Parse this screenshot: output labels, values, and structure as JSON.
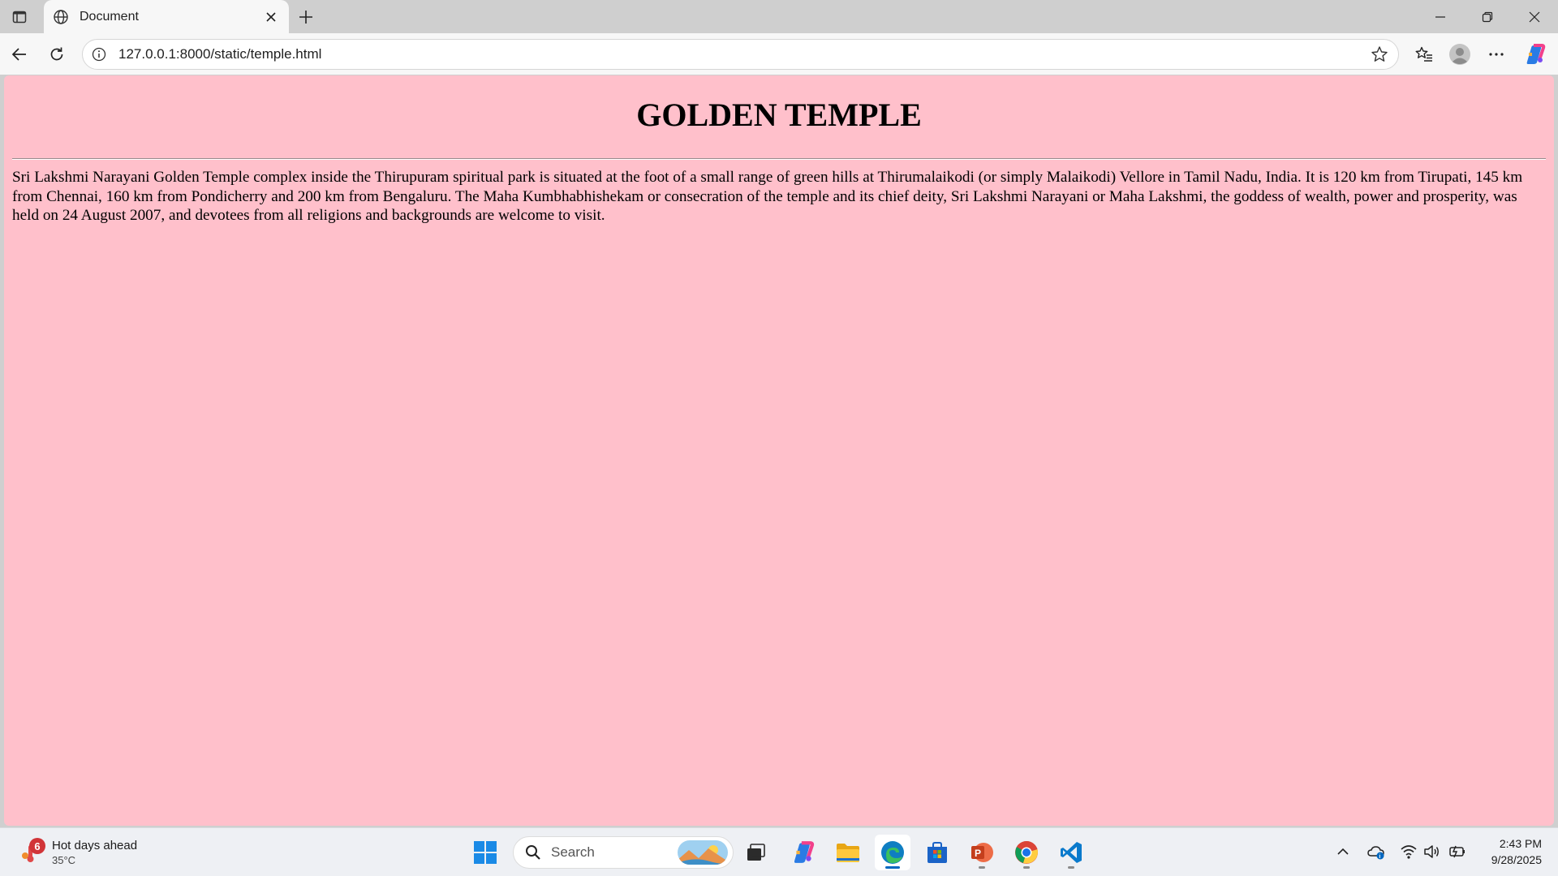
{
  "browser": {
    "tab": {
      "title": "Document",
      "favicon": "globe-icon"
    },
    "address_bar": {
      "url": "127.0.0.1:8000/static/temple.html"
    }
  },
  "page": {
    "heading": "GOLDEN TEMPLE",
    "paragraph": "Sri Lakshmi Narayani Golden Temple complex inside the Thirupuram spiritual park is situated at the foot of a small range of green hills at Thirumalaikodi (or simply Malaikodi) Vellore in Tamil Nadu, India. It is 120 km from Tirupati, 145 km from Chennai, 160 km from Pondicherry and 200 km from Bengaluru. The Maha Kumbhabhishekam or consecration of the temple and its chief deity, Sri Lakshmi Narayani or Maha Lakshmi, the goddess of wealth, power and prosperity, was held on 24 August 2007, and devotees from all religions and backgrounds are welcome to visit.",
    "background_color": "#ffc0cb"
  },
  "taskbar": {
    "weather": {
      "badge": "6",
      "title": "Hot days ahead",
      "temp": "35°C"
    },
    "search": {
      "label": "Search"
    },
    "apps": [
      "windows-start",
      "search",
      "task-view",
      "copilot",
      "file-explorer",
      "edge",
      "microsoft-store",
      "powerpoint",
      "chrome",
      "vscode"
    ],
    "clock": {
      "time": "2:43 PM",
      "date": "9/28/2025"
    }
  }
}
